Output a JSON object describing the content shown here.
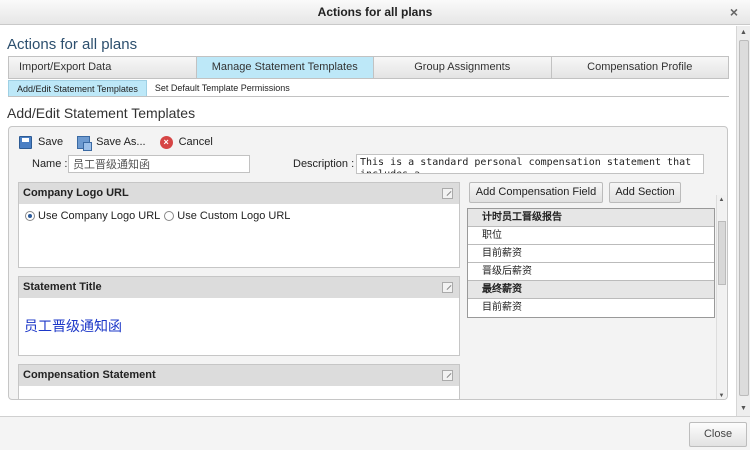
{
  "window": {
    "title": "Actions for all plans",
    "close_glyph": "×",
    "close_icon": "close-icon"
  },
  "page": {
    "title": "Actions for all plans",
    "section_title": "Add/Edit Statement Templates"
  },
  "tabs": [
    {
      "label": "Import/Export Data",
      "active": false
    },
    {
      "label": "Manage Statement Templates",
      "active": true
    },
    {
      "label": "Group Assignments",
      "active": false
    },
    {
      "label": "Compensation Profile",
      "active": false
    }
  ],
  "subtabs": [
    {
      "label": "Add/Edit Statement Templates",
      "active": true
    },
    {
      "label": "Set Default Template Permissions",
      "active": false
    }
  ],
  "toolbar": {
    "save_label": "Save",
    "save_as_label": "Save As...",
    "cancel_label": "Cancel",
    "cancel_glyph": "×"
  },
  "form": {
    "name_label": "Name :",
    "name_value": "员工晋级通知函",
    "description_label": "Description :",
    "description_value": "This is a standard personal compensation statement that includes a"
  },
  "logo_box": {
    "header": "Company Logo URL",
    "options": [
      {
        "label": "Use Company Logo URL",
        "selected": true
      },
      {
        "label": "Use Custom Logo URL",
        "selected": false
      }
    ]
  },
  "title_box": {
    "header": "Statement Title",
    "value": "员工晋级通知函"
  },
  "comp_box": {
    "header": "Compensation Statement"
  },
  "right_panel": {
    "add_field_label": "Add Compensation Field",
    "add_section_label": "Add Section",
    "rows": [
      {
        "text": "计时员工晋级报告",
        "type": "section"
      },
      {
        "text": "职位",
        "type": "field"
      },
      {
        "text": "目前薪资",
        "type": "field"
      },
      {
        "text": "晋级后薪资",
        "type": "field"
      },
      {
        "text": "最终薪资",
        "type": "section"
      },
      {
        "text": "目前薪资",
        "type": "field"
      }
    ]
  },
  "footer": {
    "close_label": "Close"
  },
  "colors": {
    "active_tab": "#bde8f8",
    "title_blue": "#2c4f6e",
    "statement_title_blue": "#1d38c8"
  }
}
